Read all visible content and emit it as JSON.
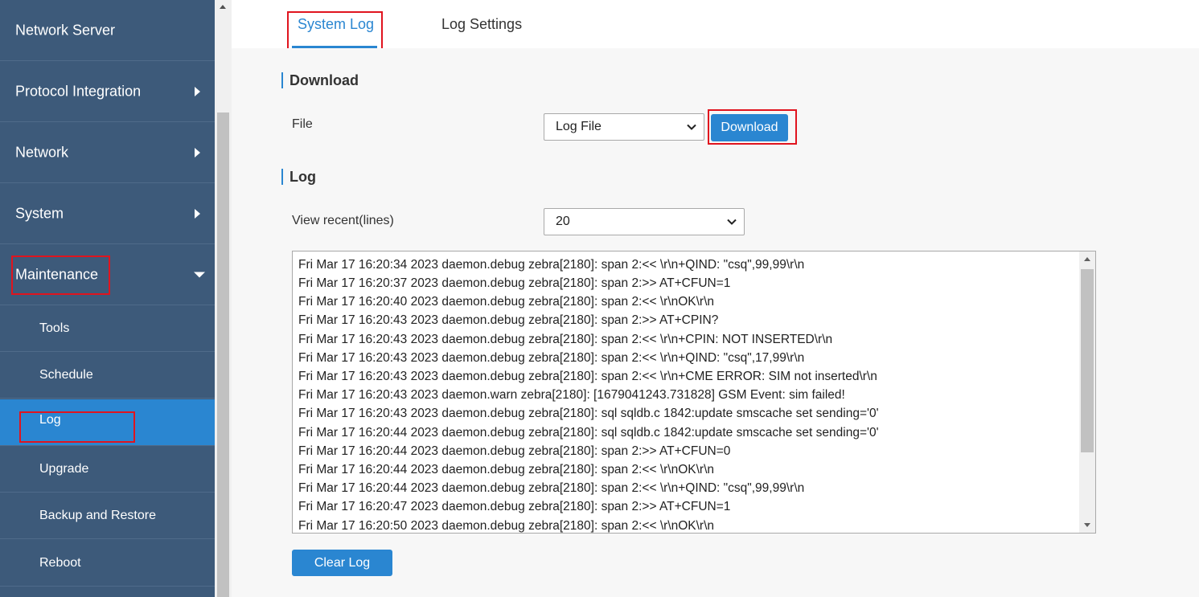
{
  "sidebar": {
    "items": [
      {
        "label": "Network Server"
      },
      {
        "label": "Protocol Integration"
      },
      {
        "label": "Network"
      },
      {
        "label": "System"
      },
      {
        "label": "Maintenance"
      }
    ],
    "sub_items": [
      {
        "label": "Tools"
      },
      {
        "label": "Schedule"
      },
      {
        "label": "Log",
        "active": true
      },
      {
        "label": "Upgrade"
      },
      {
        "label": "Backup and Restore"
      },
      {
        "label": "Reboot"
      }
    ]
  },
  "tabs": [
    {
      "label": "System Log",
      "active": true
    },
    {
      "label": "Log Settings"
    }
  ],
  "download": {
    "title": "Download",
    "file_label": "File",
    "file_value": "Log File",
    "button_label": "Download"
  },
  "log": {
    "title": "Log",
    "recent_label": "View recent(lines)",
    "recent_value": "20",
    "lines": [
      "Fri Mar 17 16:20:34 2023 daemon.debug zebra[2180]: span 2:<< \\r\\n+QIND: \"csq\",99,99\\r\\n",
      "Fri Mar 17 16:20:37 2023 daemon.debug zebra[2180]: span 2:>> AT+CFUN=1",
      "Fri Mar 17 16:20:40 2023 daemon.debug zebra[2180]: span 2:<< \\r\\nOK\\r\\n",
      "Fri Mar 17 16:20:43 2023 daemon.debug zebra[2180]: span 2:>> AT+CPIN?",
      "Fri Mar 17 16:20:43 2023 daemon.debug zebra[2180]: span 2:<< \\r\\n+CPIN: NOT INSERTED\\r\\n",
      "Fri Mar 17 16:20:43 2023 daemon.debug zebra[2180]: span 2:<< \\r\\n+QIND: \"csq\",17,99\\r\\n",
      "Fri Mar 17 16:20:43 2023 daemon.debug zebra[2180]: span 2:<< \\r\\n+CME ERROR: SIM not inserted\\r\\n",
      "Fri Mar 17 16:20:43 2023 daemon.warn zebra[2180]: [1679041243.731828] GSM Event: sim failed!",
      "Fri Mar 17 16:20:43 2023 daemon.debug zebra[2180]: sql sqldb.c 1842:update smscache set sending='0'",
      "Fri Mar 17 16:20:44 2023 daemon.debug zebra[2180]: sql sqldb.c 1842:update smscache set sending='0'",
      "Fri Mar 17 16:20:44 2023 daemon.debug zebra[2180]: span 2:>> AT+CFUN=0",
      "Fri Mar 17 16:20:44 2023 daemon.debug zebra[2180]: span 2:<< \\r\\nOK\\r\\n",
      "Fri Mar 17 16:20:44 2023 daemon.debug zebra[2180]: span 2:<< \\r\\n+QIND: \"csq\",99,99\\r\\n",
      "Fri Mar 17 16:20:47 2023 daemon.debug zebra[2180]: span 2:>> AT+CFUN=1",
      "Fri Mar 17 16:20:50 2023 daemon.debug zebra[2180]: span 2:<< \\r\\nOK\\r\\n"
    ],
    "clear_button_label": "Clear Log"
  },
  "colors": {
    "sidebar_bg": "#3d5a7a",
    "accent": "#2a86d1",
    "highlight_box": "#e0141e"
  }
}
